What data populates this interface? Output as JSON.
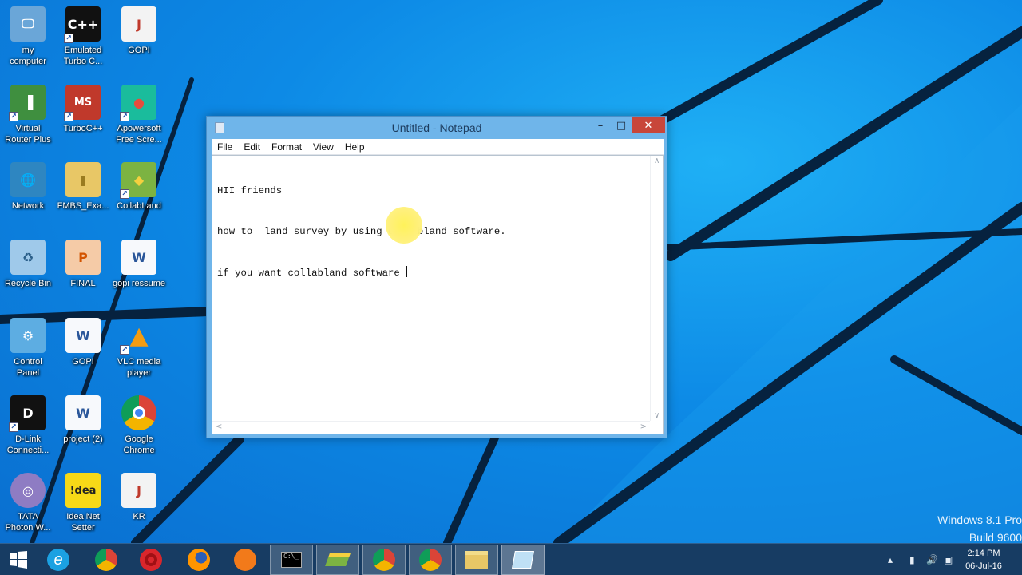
{
  "desktop": {
    "icons": [
      {
        "label": "my\ncomputer",
        "icon": "computer-icon"
      },
      {
        "label": "Emulated\nTurbo C...",
        "icon": "cpp-icon"
      },
      {
        "label": "GOPI",
        "icon": "document-icon"
      },
      {
        "label": "Virtual\nRouter Plus",
        "icon": "router-icon"
      },
      {
        "label": "TurboC++",
        "icon": "turbo-cpp-icon"
      },
      {
        "label": "Apowersoft\nFree Scre...",
        "icon": "screen-recorder-icon"
      },
      {
        "label": "Network",
        "icon": "network-icon"
      },
      {
        "label": "FMBS_Exa...",
        "icon": "folder-icon"
      },
      {
        "label": "CollabLand",
        "icon": "collabland-icon"
      },
      {
        "label": "Recycle Bin",
        "icon": "recycle-bin-icon"
      },
      {
        "label": "FINAL",
        "icon": "powerpoint-icon"
      },
      {
        "label": "gopi ressume",
        "icon": "word-icon"
      },
      {
        "label": "Control\nPanel",
        "icon": "control-panel-icon"
      },
      {
        "label": "GOPI",
        "icon": "word-icon"
      },
      {
        "label": "VLC media\nplayer",
        "icon": "vlc-icon"
      },
      {
        "label": "D-Link\nConnecti...",
        "icon": "dlink-icon"
      },
      {
        "label": "project (2)",
        "icon": "word-icon"
      },
      {
        "label": "Google\nChrome",
        "icon": "chrome-icon"
      },
      {
        "label": "TATA\nPhoton W...",
        "icon": "tata-photon-icon"
      },
      {
        "label": "Idea Net\nSetter",
        "icon": "idea-icon"
      },
      {
        "label": "KR",
        "icon": "document-icon"
      }
    ]
  },
  "notepad": {
    "title": "Untitled - Notepad",
    "minimize": "–",
    "maximize": "□",
    "close": "✕",
    "menu": [
      "File",
      "Edit",
      "Format",
      "View",
      "Help"
    ],
    "text_lines": [
      "HII friends",
      "how to  land survey by using collabland software.",
      "if you want collabland software "
    ]
  },
  "watermark": {
    "line1": "Windows 8.1 Pro",
    "line2": "Build 9600"
  },
  "taskbar": {
    "apps": [
      "start-icon",
      "ie-icon",
      "chrome-icon",
      "opera-icon",
      "firefox-icon",
      "avast-icon",
      "cmd-icon",
      "collabland-icon",
      "chrome-icon",
      "chrome-icon",
      "file-explorer-icon",
      "notepad-icon"
    ],
    "clock_time": "2:14 PM",
    "clock_date": "06-Jul-16"
  },
  "colors": {
    "desktop_blue": "#0d8ae6",
    "taskbar": "#173c63",
    "window_frame": "#6fb5ea",
    "close_red": "#c8463a"
  }
}
